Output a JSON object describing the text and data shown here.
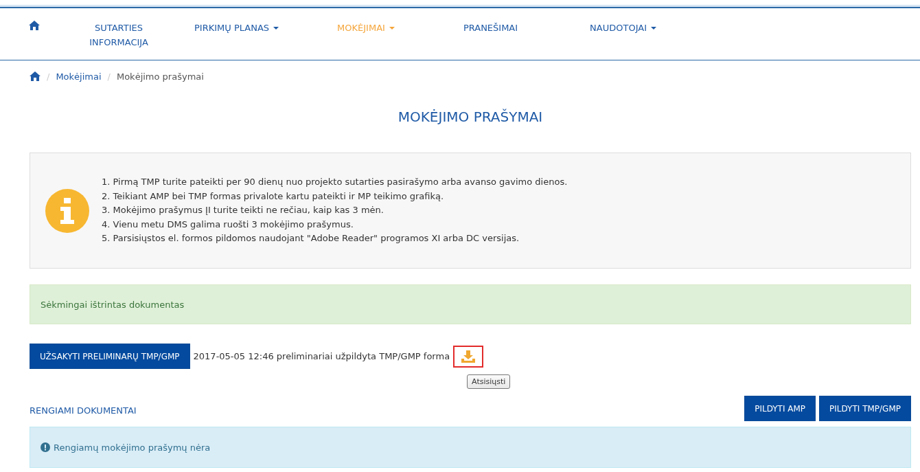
{
  "nav": {
    "items": [
      {
        "kind": "home"
      },
      {
        "kind": "text",
        "label": "SUTARTIES INFORMACIJA",
        "selected": false,
        "dropdown": false
      },
      {
        "kind": "text",
        "label": "PIRKIMŲ PLANAS",
        "selected": false,
        "dropdown": true
      },
      {
        "kind": "text",
        "label": "MOKĖJIMAI",
        "selected": true,
        "dropdown": true
      },
      {
        "kind": "text",
        "label": "PRANEŠIMAI",
        "selected": false,
        "dropdown": false
      },
      {
        "kind": "text",
        "label": "NAUDOTOJAI",
        "selected": false,
        "dropdown": true
      }
    ]
  },
  "breadcrumb": [
    {
      "kind": "home"
    },
    {
      "kind": "separator",
      "label": "/"
    },
    {
      "kind": "link",
      "label": "Mokėjimai"
    },
    {
      "kind": "separator",
      "label": "/"
    },
    {
      "kind": "current",
      "label": "Mokėjimo prašymai"
    }
  ],
  "page_title": "MOKĖJIMO PRAŠYMAI",
  "info_box": {
    "lines": [
      "1. Pirmą TMP turite pateikti per 90 dienų nuo projekto sutarties pasirašymo arba avanso gavimo dienos.",
      "2. Teikiant AMP bei TMP formas privalote kartu pateikti ir MP teikimo grafiką.",
      "3. Mokėjimo prašymus ĮI turite teikti ne rečiau, kaip kas 3 mėn.",
      "4. Vienu metu DMS galima ruošti 3 mokėjimo prašymus.",
      "5. Parsisiųstos el. formos pildomos naudojant \"Adobe Reader\" programos XI arba DC versijas."
    ]
  },
  "success_alert": "Sėkmingai ištrintas dokumentas",
  "preliminary": {
    "button": "UŽSAKYTI PRELIMINARŲ TMP/GMP",
    "note": "2017-05-05 12:46 preliminariai užpildyta TMP/GMP forma",
    "download_highlighted": true,
    "tooltip": "Atsisiųsti"
  },
  "section": {
    "title": "RENGIAMI DOKUMENTAI",
    "buttons": [
      "PILDYTI AMP",
      "PILDYTI TMP/GMP"
    ]
  },
  "empty_alert": "Rengiamų mokėjimo prašymų nėra"
}
